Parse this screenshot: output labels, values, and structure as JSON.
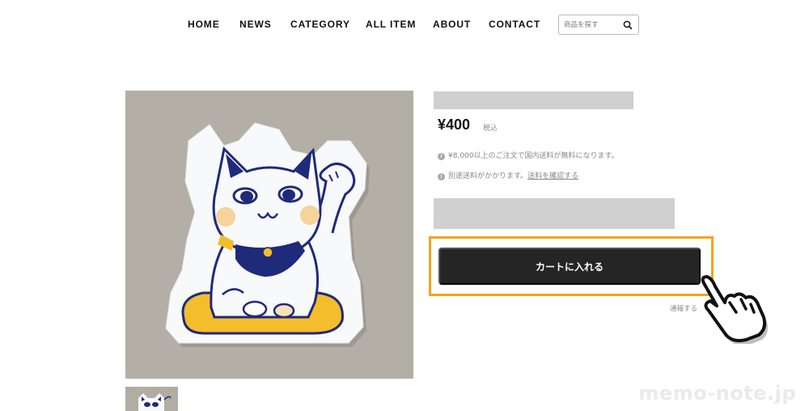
{
  "nav": {
    "items": [
      {
        "label": "HOME"
      },
      {
        "label": "NEWS"
      },
      {
        "label": "CATEGORY"
      },
      {
        "label": "ALL ITEM"
      },
      {
        "label": "ABOUT"
      },
      {
        "label": "CONTACT"
      }
    ],
    "search_placeholder": "商品を探す",
    "search_icon": "search-icon"
  },
  "product": {
    "price": "¥400",
    "tax_label": "税込",
    "notes": [
      {
        "text": "¥8,000以上のご注文で国内送料が無料になります。",
        "link": ""
      },
      {
        "text": "別途送料がかかります。",
        "link": "送料を確認する"
      }
    ],
    "info_icon": "info-icon",
    "cart_button": "カートに入れる",
    "report_link": "通報する"
  },
  "overlay": {
    "hand_icon": "pointing-hand-icon",
    "highlight_color": "#f2a51a"
  },
  "watermark": "memo-note.jp",
  "colors": {
    "cart_button": "#252525",
    "placeholder": "#d0d0d0",
    "cat_blue": "#1f2a7a",
    "cushion_yellow": "#f4bd2c",
    "photo_background": "#b2aca3"
  }
}
